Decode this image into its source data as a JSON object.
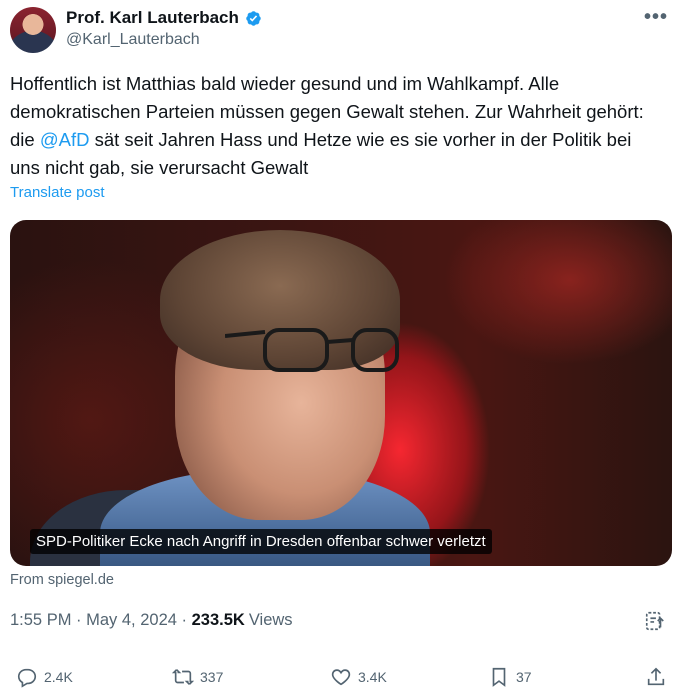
{
  "author": {
    "display_name": "Prof. Karl Lauterbach",
    "handle": "@Karl_Lauterbach",
    "verified_icon": "verified-badge-icon",
    "avatar_icon": "avatar"
  },
  "menu": {
    "more_icon": "more-options-icon",
    "label": "•••"
  },
  "post": {
    "text_part1": "Hoffentlich ist Matthias bald wieder gesund und im Wahlkampf. Alle demokratischen Parteien müssen gegen Gewalt stehen. Zur Wahrheit gehört: die ",
    "mention": "@AfD",
    "text_part2": " sät seit Jahren Hass und Hetze wie es sie vorher in der Politik bei uns nicht gab, sie verursacht Gewalt",
    "translate_label": "Translate post"
  },
  "media": {
    "caption": "SPD-Politiker Ecke nach Angriff in Dresden offenbar schwer verletzt",
    "source": "From spiegel.de"
  },
  "meta": {
    "time": "1:55 PM",
    "separator": " · ",
    "date": "May 4, 2024",
    "views_count": "233.5K",
    "views_label": "Views",
    "analytics_icon": "analytics-icon"
  },
  "actions": {
    "replies": "2.4K",
    "reposts": "337",
    "likes": "3.4K",
    "bookmarks": "37"
  },
  "colors": {
    "accent": "#1d9bf0",
    "secondary_text": "#536471",
    "primary_text": "#0f1419"
  }
}
